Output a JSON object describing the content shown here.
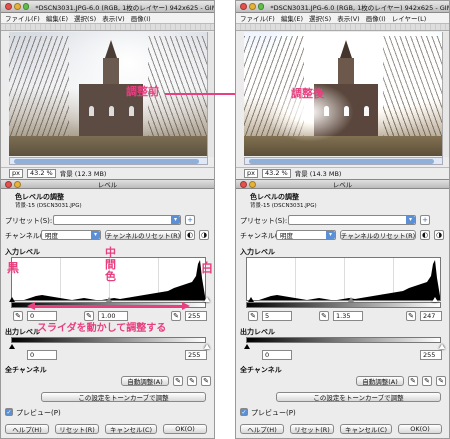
{
  "window": {
    "title": "*DSCN3031.JPG-6.0 (RGB, 1枚のレイヤー) 942x625 - GIMP"
  },
  "menu": [
    "ファイル(F)",
    "編集(E)",
    "選択(S)",
    "表示(V)",
    "画像(I)",
    "レイヤー(L)"
  ],
  "status": {
    "unit": "px",
    "zoom": "43.2 %",
    "left_info": "背景 (12.3 MB)",
    "right_info": "背景 (14.3 MB)"
  },
  "dialog": {
    "window_title": "レベル",
    "header": "色レベルの調整",
    "subheader": "背景-15 (DSCN3031.JPG)",
    "preset_label": "プリセット(S):",
    "channel_label": "チャンネル(N):",
    "channel_value": "明度",
    "reset_channel": "チャンネルのリセット(R)",
    "input_levels": "入力レベル",
    "output_levels": "出力レベル",
    "all_channels": "全チャンネル",
    "auto_button": "自動調整(A)",
    "curves_button": "この設定をトーンカーブで調整",
    "preview_label": "プレビュー(P)",
    "help": "ヘルプ(H)",
    "reset": "リセット(R)",
    "cancel": "キャンセル(C)",
    "ok": "OK(O)",
    "left_inputs": [
      "0",
      "1.00",
      "255"
    ],
    "right_inputs": [
      "5",
      "1.35",
      "247"
    ],
    "output_values": [
      "0",
      "255"
    ]
  },
  "annotations": {
    "before": "調整前",
    "after": "調整後",
    "black": "黒",
    "middle": "中間色",
    "white": "白",
    "slider_hint": "スライダを動かして調整する",
    "accent_color": "#e73f7f"
  }
}
